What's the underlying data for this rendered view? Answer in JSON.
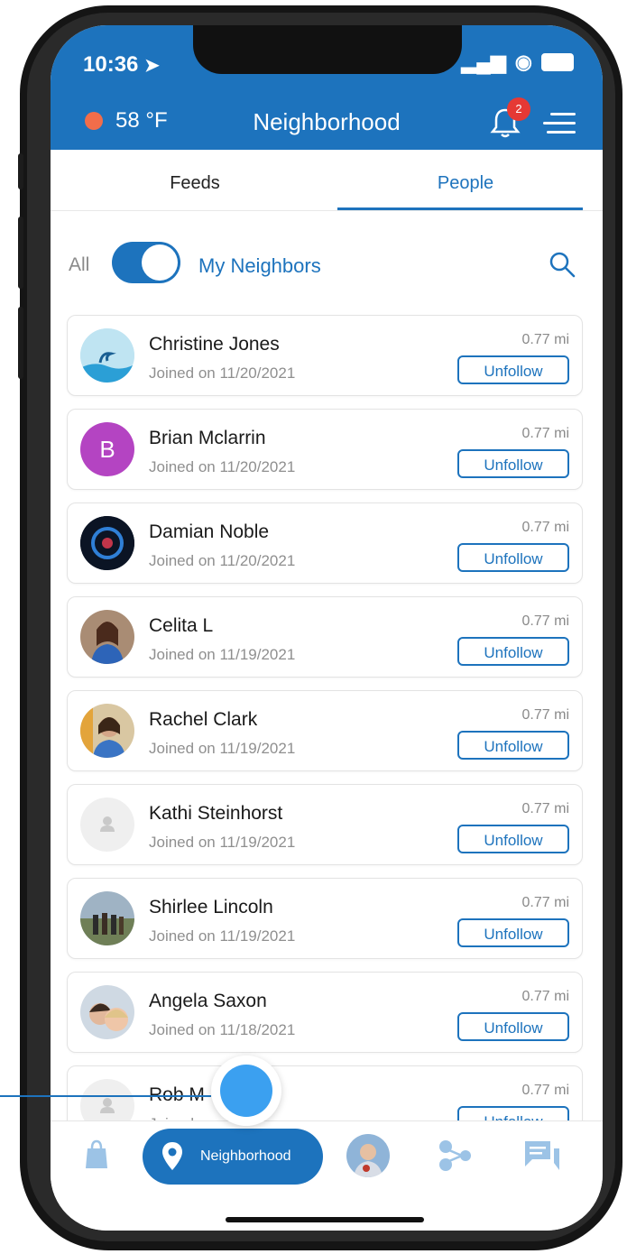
{
  "status": {
    "time": "10:36"
  },
  "header": {
    "temperature": "58 °F",
    "title": "Neighborhood",
    "notification_count": "2"
  },
  "tabs": [
    {
      "label": "Feeds"
    },
    {
      "label": "People"
    }
  ],
  "filter": {
    "all_label": "All",
    "my_label": "My Neighbors",
    "toggle_on": true
  },
  "people": [
    {
      "name": "Christine Jones",
      "joined": "Joined on 11/20/2021",
      "distance": "0.77 mi",
      "button": "Unfollow",
      "avatar": "wave-avatar"
    },
    {
      "name": "Brian Mclarrin",
      "joined": "Joined on 11/20/2021",
      "distance": "0.77 mi",
      "button": "Unfollow",
      "avatar_letter": "B"
    },
    {
      "name": "Damian Noble",
      "joined": "Joined on 11/20/2021",
      "distance": "0.77 mi",
      "button": "Unfollow",
      "avatar": "emblem-avatar"
    },
    {
      "name": "Celita L",
      "joined": "Joined on 11/19/2021",
      "distance": "0.77 mi",
      "button": "Unfollow",
      "avatar": "photo-avatar"
    },
    {
      "name": "Rachel Clark",
      "joined": "Joined on 11/19/2021",
      "distance": "0.77 mi",
      "button": "Unfollow",
      "avatar": "photo-avatar"
    },
    {
      "name": "Kathi Steinhorst",
      "joined": "Joined on 11/19/2021",
      "distance": "0.77 mi",
      "button": "Unfollow",
      "avatar": "placeholder-avatar"
    },
    {
      "name": "Shirlee Lincoln",
      "joined": "Joined on 11/19/2021",
      "distance": "0.77 mi",
      "button": "Unfollow",
      "avatar": "photo-avatar"
    },
    {
      "name": "Angela Saxon",
      "joined": "Joined on 11/18/2021",
      "distance": "0.77 mi",
      "button": "Unfollow",
      "avatar": "photo-avatar"
    },
    {
      "name": "Rob M",
      "joined": "Joined",
      "distance": "0.77 mi",
      "button": "Unfollow",
      "avatar": "placeholder-avatar"
    }
  ],
  "bottom_nav": {
    "active_label": "Neighborhood"
  },
  "colors": {
    "primary": "#1d73bd",
    "fab": "#3ba0f0",
    "temp_dot": "#f26d4a",
    "badge": "#e53935"
  }
}
